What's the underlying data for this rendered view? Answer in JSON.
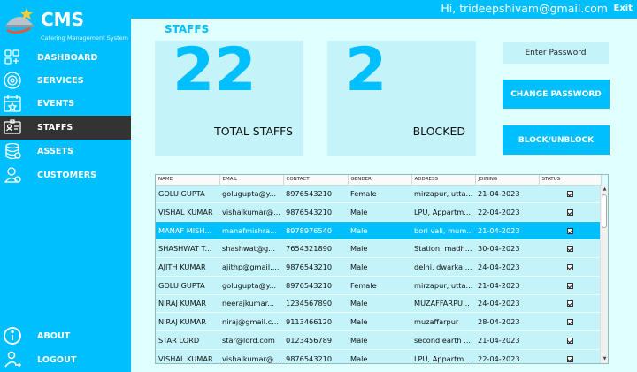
{
  "header": {
    "greeting": "Hi, trideepshivam@gmail.com",
    "exit_label": "Exit"
  },
  "brand": {
    "title": "CMS",
    "subtitle": "Catering Management System"
  },
  "sidebar": {
    "items": [
      {
        "label": "DASHBOARD",
        "icon": "dashboard-icon"
      },
      {
        "label": "SERVICES",
        "icon": "services-icon"
      },
      {
        "label": "EVENTS",
        "icon": "calendar-icon"
      },
      {
        "label": "STAFFS",
        "icon": "id-card-icon",
        "active": true
      },
      {
        "label": "ASSETS",
        "icon": "database-icon"
      },
      {
        "label": "CUSTOMERS",
        "icon": "user-icon"
      }
    ],
    "bottom": [
      {
        "label": "ABOUT",
        "icon": "info-icon"
      },
      {
        "label": "LOGOUT",
        "icon": "logout-icon"
      }
    ]
  },
  "page": {
    "title": "STAFFS"
  },
  "stats": {
    "total": {
      "value": "22",
      "label": "TOTAL STAFFS"
    },
    "blocked": {
      "value": "2",
      "label": "BLOCKED"
    }
  },
  "actions": {
    "password_placeholder": "Enter Password",
    "change_password": "CHANGE PASSWORD",
    "block_unblock": "BLOCK/UNBLOCK"
  },
  "table": {
    "headers": [
      "NAME",
      "EMAIL",
      "CONTACT",
      "GENDER",
      "ADDRESS",
      "JOINING",
      "STATUS"
    ],
    "rows": [
      [
        "GOLU GUPTA",
        "golugupta@y...",
        "8976543210",
        "Female",
        "mirzapur, utta...",
        "21-04-2023"
      ],
      [
        "VISHAL KUMAR",
        "vishalkumar@...",
        "9876543210",
        "Male",
        "LPU, Appartm...",
        "22-04-2023"
      ],
      [
        "MANAF MISH...",
        "manafmishra...",
        "8978976540",
        "Male",
        "bori vali, mum...",
        "21-04-2023"
      ],
      [
        "SHASHWAT T...",
        "shashwat@g...",
        "7654321890",
        "Male",
        "Station, madh...",
        "30-04-2023"
      ],
      [
        "AJITH KUMAR",
        "ajithp@gmail....",
        "9876543210",
        "Male",
        "delhi, dwarka,...",
        "24-04-2023"
      ],
      [
        "GOLU GUPTA",
        "golugupta@y...",
        "8976543210",
        "Female",
        "mirzapur, utta...",
        "21-04-2023"
      ],
      [
        "NIRAJ KUMAR",
        "neerajkumar...",
        "1234567890",
        "Male",
        "MUZAFFARPU...",
        "24-04-2023"
      ],
      [
        "NIRAJ KUMAR",
        "niraj@gmail.c...",
        "9113466120",
        "Male",
        "muzaffarpur",
        "28-04-2023"
      ],
      [
        "STAR LORD",
        "star@lord.com",
        "0123456789",
        "Male",
        "second earth ...",
        "21-04-2023"
      ],
      [
        "VISHAL KUMAR",
        "vishalkumar@...",
        "9876543210",
        "Male",
        "LPU, Appartm...",
        "22-04-2023"
      ]
    ],
    "selected_row": 2
  },
  "colors": {
    "accent": "#00bfff",
    "panel": "#e0ffff",
    "card": "#c4f4fa",
    "active_nav": "#333333"
  }
}
